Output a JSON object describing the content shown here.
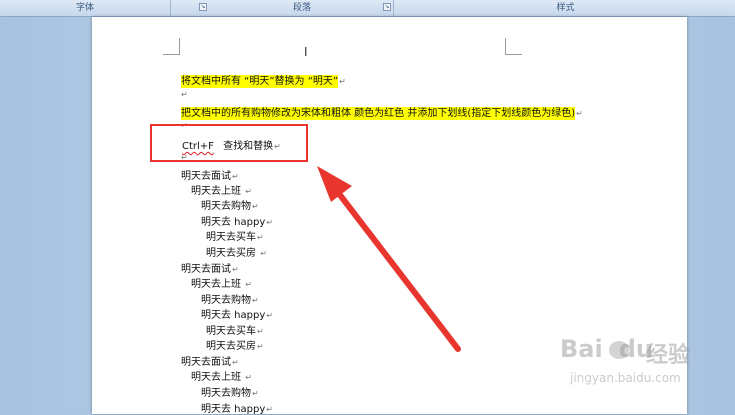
{
  "ribbon": {
    "groups": [
      "字体",
      "段落",
      "样式"
    ]
  },
  "document": {
    "instruction1": "将文档中所有 “明天”替换为 “明天”",
    "instruction2": "把文档中的所有购物修改为宋体和粗体 颜色为红色 并添加下划线(指定下划线颜色为绿色)",
    "shortcut_key": "Ctrl+F",
    "shortcut_desc": "查找和替换",
    "para_mark": "↵",
    "lines": [
      "明天去面试",
      "明天去上班",
      "明天去购物",
      "明天去 happy",
      "明天去买车",
      "明天去买房",
      "明天去面试",
      "明天去上班",
      "明天去购物",
      "明天去 happy",
      "明天去买车",
      "明天去买房",
      "明天去面试",
      "明天去上班",
      "明天去购物",
      "明天去 happy"
    ]
  },
  "watermark": {
    "logo": "Bai",
    "logo_suffix": "du",
    "cn": "经验",
    "url": "jingyan.baidu.com"
  },
  "colors": {
    "highlight": "#ffff00",
    "annotation_red": "#e8362e",
    "ribbon_label": "#3b5a82"
  }
}
